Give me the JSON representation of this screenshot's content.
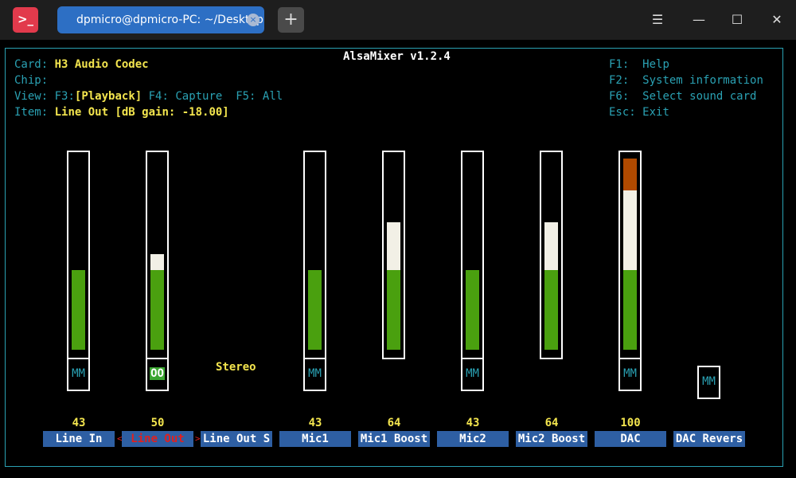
{
  "window": {
    "tab_title": "dpmicro@dpmicro-PC: ~/Desktop",
    "app_icon_glyph": ">_",
    "tab_close_glyph": "×",
    "new_tab_glyph": "+",
    "menu_glyph": "☰",
    "minimize_glyph": "—",
    "maximize_glyph": "☐",
    "close_glyph": "✕"
  },
  "mixer": {
    "title": "AlsaMixer v1.2.4",
    "card_label": "Card:",
    "card_value": "H3 Audio Codec",
    "chip_label": "Chip:",
    "chip_value": "",
    "view_label": "View:",
    "view_f3_key": "F3:",
    "view_f3": "[Playback]",
    "view_f4": "F4: Capture",
    "view_f5": "F5: All",
    "item_label": "Item:",
    "item_value": "Line Out [dB gain: -18.00]",
    "help": [
      {
        "key": "F1:",
        "text": "Help"
      },
      {
        "key": "F2:",
        "text": "System information"
      },
      {
        "key": "F6:",
        "text": "Select sound card"
      },
      {
        "key": "Esc:",
        "text": "Exit"
      }
    ],
    "stereo_label": "Stereo",
    "chevron_left": "<",
    "chevron_right": ">",
    "controls": [
      {
        "name": "Line In",
        "value": "43",
        "level": 0.43,
        "mute": "MM"
      },
      {
        "name": "Line Out",
        "value": "50",
        "level": 0.5,
        "mute": "OO",
        "active": true
      },
      {
        "name": "Line Out S",
        "value": "",
        "level": null,
        "mute": ""
      },
      {
        "name": "Mic1",
        "value": "43",
        "level": 0.43,
        "mute": "MM"
      },
      {
        "name": "Mic1 Boost",
        "value": "64",
        "level": 0.64,
        "mute": ""
      },
      {
        "name": "Mic2",
        "value": "43",
        "level": 0.43,
        "mute": "MM"
      },
      {
        "name": "Mic2 Boost",
        "value": "64",
        "level": 0.64,
        "mute": ""
      },
      {
        "name": "DAC",
        "value": "100",
        "level": 1.0,
        "mute": "MM"
      },
      {
        "name": "DAC Revers",
        "value": "",
        "level": null,
        "mute": "MM"
      }
    ],
    "colors": {
      "frame": "#2aa1b3",
      "highlight": "#f3e54e",
      "green": "#4aa00f",
      "white": "#f2f0e6",
      "red": "#b04a00",
      "label_bg": "#2e5fa3"
    }
  }
}
